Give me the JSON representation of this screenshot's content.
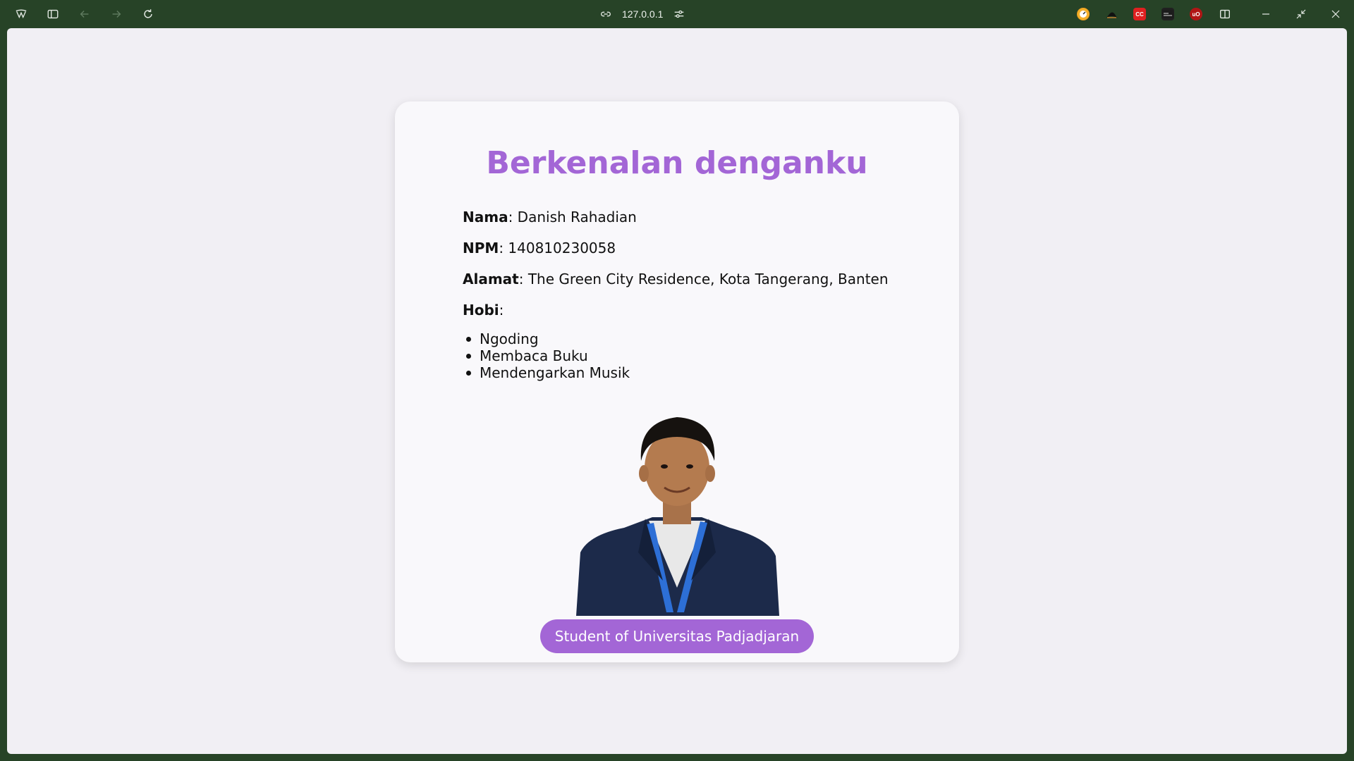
{
  "browser": {
    "url": "127.0.0.1",
    "extensions": [
      {
        "name": "clock-extension",
        "color": "#f0a020"
      },
      {
        "name": "hat-extension",
        "color": "#1e1e1e"
      },
      {
        "name": "cc-extension",
        "label": "CC",
        "color": "#e02020"
      },
      {
        "name": "terminal-extension",
        "color": "#202020"
      },
      {
        "name": "ublock-extension",
        "label": "UO",
        "color": "#b01515"
      }
    ]
  },
  "profile": {
    "title": "Berkenalan denganku",
    "nama_label": "Nama",
    "nama_value": ": Danish Rahadian",
    "npm_label": "NPM",
    "npm_value": ": 140810230058",
    "alamat_label": "Alamat",
    "alamat_value": ": The Green City Residence, Kota Tangerang, Banten",
    "hobi_label": "Hobi",
    "hobi_sep": ":",
    "hobbies": [
      "Ngoding",
      "Membaca Buku",
      "Mendengarkan Musik"
    ],
    "badge": "Student of Universitas Padjadjaran"
  },
  "colors": {
    "accent": "#a366d6",
    "chrome": "#274327",
    "page_bg": "#f1eff4",
    "card_bg": "#f9f8fb"
  }
}
